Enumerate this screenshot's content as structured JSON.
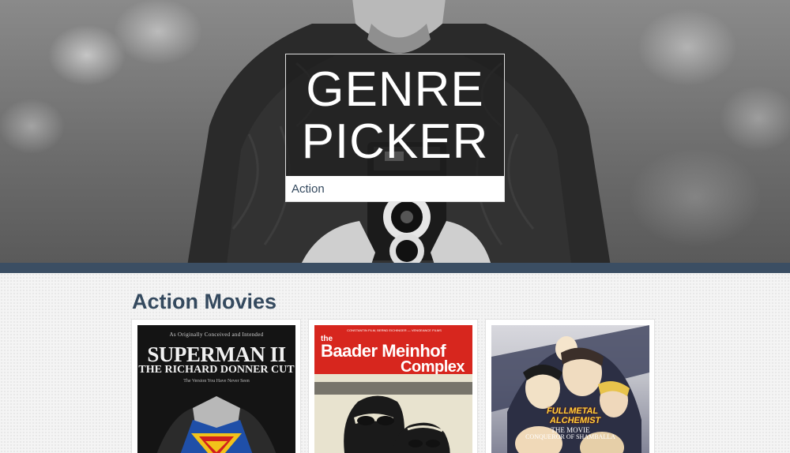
{
  "hero": {
    "title_line1": "GENRE",
    "title_line2": "PICKER",
    "genre_value": "Action"
  },
  "main": {
    "section_title": "Action Movies",
    "movies": [
      {
        "title": "Superman II: The Richard Donner Cut",
        "poster_lines": [
          "As Originally Conceived and Intended",
          "SUPERMAN II",
          "THE RICHARD DONNER CUT",
          "The Version You Have Never Seen"
        ]
      },
      {
        "title": "The Baader Meinhof Complex",
        "poster_lines": [
          "CONSTANTIN FILM, BERND EICHINGER — VENGEANCE FILMS",
          "the",
          "Baader Meinhof",
          "Complex"
        ]
      },
      {
        "title": "Fullmetal Alchemist the Movie: Conqueror of Shamballa",
        "poster_lines": [
          "FULLMETAL",
          "ALCHEMIST",
          "THE MOVIE",
          "CONQUEROR OF SHAMBALLA"
        ]
      }
    ]
  },
  "colors": {
    "accent": "#3b4e63",
    "heading": "#34495e",
    "page_bg": "#f4f4f4"
  }
}
